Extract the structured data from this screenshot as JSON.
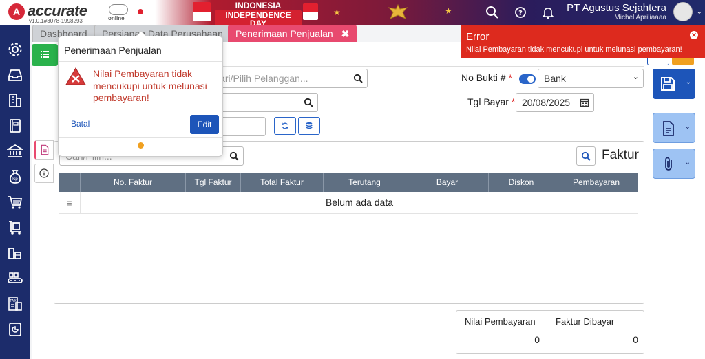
{
  "header": {
    "logo_text": "accurate",
    "logo_letter": "A",
    "cloud_label": "online",
    "version": "v1.0.1#3078-1998293",
    "banner_line1": "INDONESIA",
    "banner_line2": "INDEPENDENCE DAY",
    "company_name": "PT Agustus Sejahtera",
    "user_name": "Michel Apriliaaaa"
  },
  "tabs": [
    {
      "label": "Dashboard"
    },
    {
      "label": "Persiapan Data Perusahaan"
    },
    {
      "label": "Penerimaan Penjualan",
      "close": "✖"
    }
  ],
  "form": {
    "customer_placeholder": "Cari/Pilih Pelanggan...",
    "no_bukti_label": "No Bukti #",
    "required_mark": "*",
    "no_bukti_value": "Bank",
    "tgl_bayar_label": "Tgl Bayar",
    "tgl_bayar_value": "20/08/2025"
  },
  "panel": {
    "search_placeholder": "Cari/Pilih...",
    "title": "Faktur",
    "columns": [
      "No. Faktur",
      "Tgl Faktur",
      "Total Faktur",
      "Terutang",
      "Bayar",
      "Diskon",
      "Pembayaran"
    ],
    "empty_message": "Belum ada data",
    "row_handle": "≡"
  },
  "summary": {
    "nilai_label": "Nilai Pembayaran",
    "nilai_value": "0",
    "faktur_label": "Faktur Dibayar",
    "faktur_value": "0"
  },
  "popover": {
    "title": "Penerimaan Penjualan",
    "message": "Nilai Pembayaran tidak mencukupi untuk melunasi pembayaran!",
    "cancel_label": "Batal",
    "edit_label": "Edit"
  },
  "toast": {
    "title": "Error",
    "message": "Nilai Pembayaran tidak mencukupi untuk melunasi pembayaran!",
    "close_glyph": "✕"
  },
  "colors": {
    "sidebar": "#1c2c6b",
    "active_tab": "#e84a6f",
    "primary": "#1d55b9",
    "error": "#dd2a1e",
    "success": "#2ab24c"
  },
  "icons": {
    "sidebar": [
      "gear-icon",
      "inbox-icon",
      "building-icon",
      "book-icon",
      "bank-icon",
      "money-bag-icon",
      "cart-icon",
      "dolly-icon",
      "warehouse-icon",
      "conveyor-icon",
      "tax-icon",
      "report-icon"
    ]
  }
}
